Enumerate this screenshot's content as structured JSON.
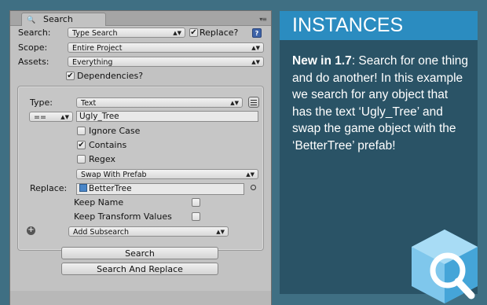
{
  "tab": {
    "title": "Search"
  },
  "form": {
    "search_label": "Search:",
    "search_value": "Type Search",
    "replace_toggle_label": "Replace?",
    "scope_label": "Scope:",
    "scope_value": "Entire Project",
    "assets_label": "Assets:",
    "assets_value": "Everything",
    "dependencies_label": "Dependencies?"
  },
  "subsearch": {
    "type_label": "Type:",
    "type_value": "Text",
    "operator_value": "==",
    "text_value": "Ugly_Tree",
    "ignore_case_label": "Ignore Case",
    "contains_label": "Contains",
    "regex_label": "Regex",
    "action_value": "Swap With Prefab",
    "replace_label": "Replace:",
    "replace_object": "BetterTree",
    "keep_name_label": "Keep Name",
    "keep_transform_label": "Keep Transform Values",
    "add_subsearch_value": "Add Subsearch"
  },
  "buttons": {
    "search": "Search",
    "search_and_replace": "Search And Replace"
  },
  "checks": {
    "replace": true,
    "dependencies": true,
    "ignore_case": false,
    "contains": true,
    "regex": false,
    "keep_name": false,
    "keep_transform": false
  },
  "promo": {
    "title": "INSTANCES",
    "new_in": "New in 1.7",
    "body": ": Search for one thing and do another! In this example we search for any object that has the text ‘Ugly_Tree’ and swap the game object with the ‘BetterTree’ prefab!"
  },
  "icons": {
    "check": "✔",
    "dropdown": "▾",
    "tab_search": "search-icon",
    "help": "help-icon",
    "add": "add-circle-icon",
    "object": "prefab-cube-icon",
    "picker": "object-picker-icon",
    "logo": "search-cube-logo-icon"
  },
  "colors": {
    "background": "#3f6f83",
    "panel": "#c2c2c2",
    "promo_bg": "#2a5366",
    "promo_header": "#2b8cc0"
  }
}
